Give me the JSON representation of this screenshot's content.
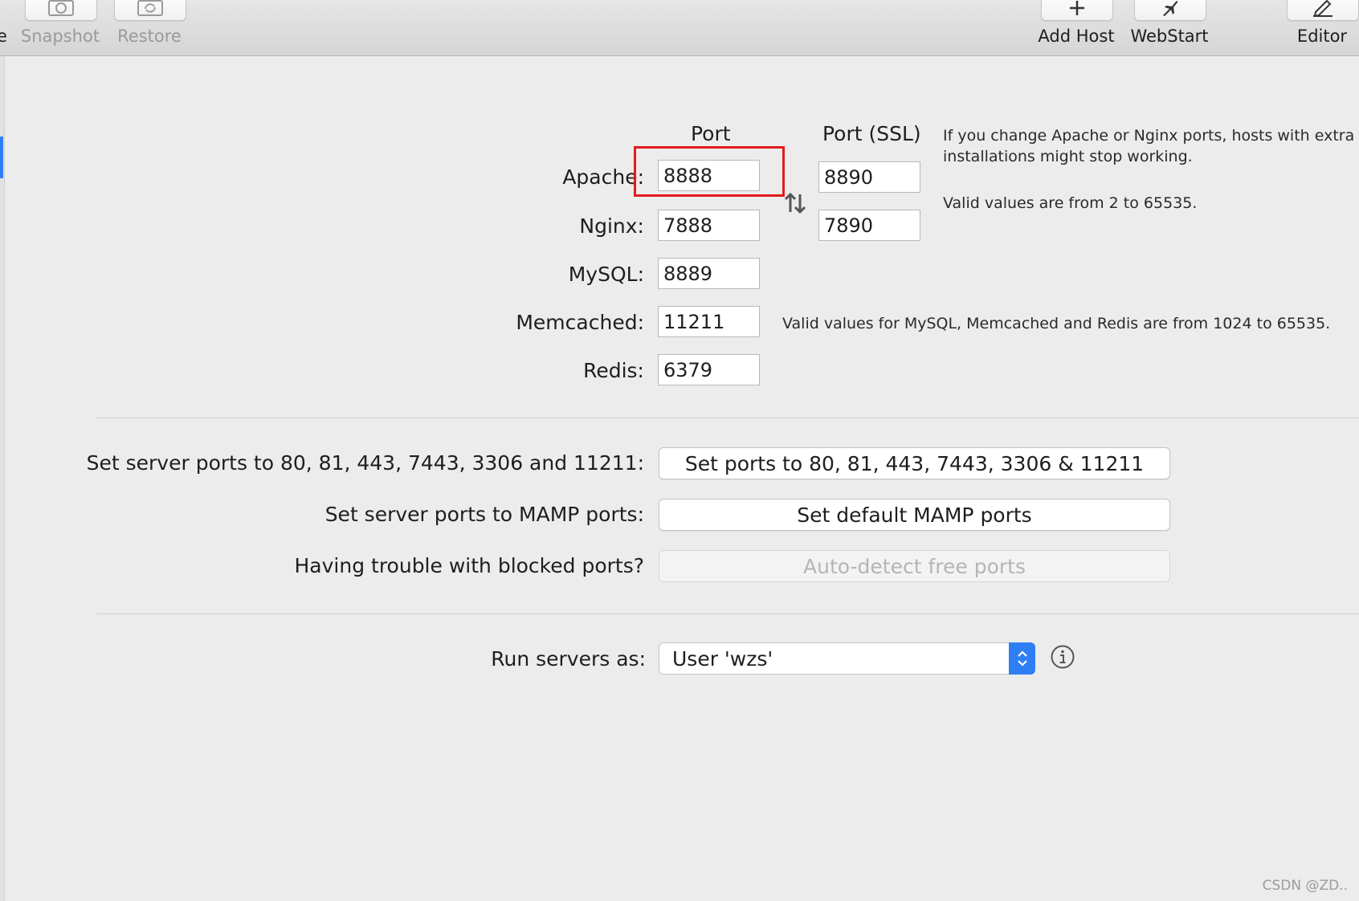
{
  "toolbar": {
    "partial_label": "e",
    "snapshot": {
      "label": "Snapshot",
      "icon": "camera-icon"
    },
    "restore": {
      "label": "Restore",
      "icon": "restore-icon"
    },
    "add_host": {
      "label": "Add Host",
      "icon": "plus-icon"
    },
    "webstart": {
      "label": "WebStart",
      "icon": "airplane-icon"
    },
    "editor": {
      "label": "Editor",
      "icon": "pencil-icon"
    }
  },
  "ports": {
    "col_port": "Port",
    "col_port_ssl": "Port (SSL)",
    "apache": {
      "label": "Apache:",
      "port": "8888",
      "ssl": "8890"
    },
    "nginx": {
      "label": "Nginx:",
      "port": "7888",
      "ssl": "7890"
    },
    "mysql": {
      "label": "MySQL:",
      "port": "8889"
    },
    "memcached": {
      "label": "Memcached:",
      "port": "11211"
    },
    "redis": {
      "label": "Redis:",
      "port": "6379"
    },
    "note_change_line1": "If you change Apache or Nginx ports, hosts with extra",
    "note_change_line2": "installations might stop working.",
    "note_valid_web": "Valid values are from 2 to 65535.",
    "note_valid_db": "Valid values for MySQL, Memcached and Redis are from 1024 to 65535.",
    "swap_icon": "swap-arrows-icon"
  },
  "actions": {
    "standard_label": "Set server ports to 80, 81, 443, 7443, 3306 and 11211:",
    "standard_button": "Set ports to 80, 81, 443, 7443, 3306 & 11211",
    "mamp_label": "Set server ports to MAMP ports:",
    "mamp_button": "Set default MAMP ports",
    "blocked_label": "Having trouble with blocked ports?",
    "blocked_button": "Auto-detect free ports"
  },
  "run_as": {
    "label": "Run servers as:",
    "value": "User 'wzs'",
    "info_icon": "info-icon"
  },
  "watermark": "CSDN @ZD..",
  "colors": {
    "accent": "#2f7ff4",
    "highlight": "#e31b1b",
    "background": "#ececec"
  }
}
